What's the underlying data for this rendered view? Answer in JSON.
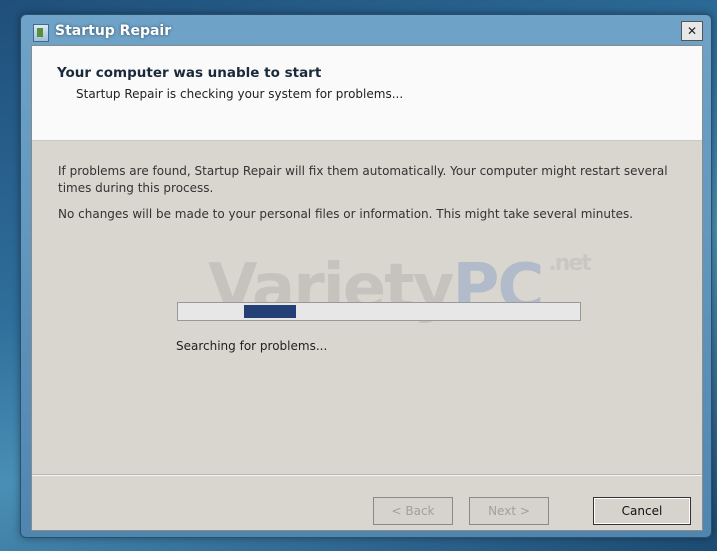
{
  "window": {
    "title": "Startup Repair"
  },
  "header": {
    "title": "Your computer was unable to start",
    "subtitle": "Startup Repair is checking your system for problems..."
  },
  "body": {
    "paragraph1": "If problems are found, Startup Repair will fix them automatically. Your computer might restart several times during this process.",
    "paragraph2": "No changes will be made to your personal files or information. This might take several minutes."
  },
  "watermark": {
    "part1": "Variety",
    "part2": "PC",
    "part3": ".net"
  },
  "progress": {
    "status_text": "Searching for problems...",
    "style": "marquee"
  },
  "buttons": {
    "back": "< Back",
    "next": "Next >",
    "cancel": "Cancel"
  },
  "colors": {
    "progress": "#233f76",
    "window_frame": "#4f86b0"
  }
}
